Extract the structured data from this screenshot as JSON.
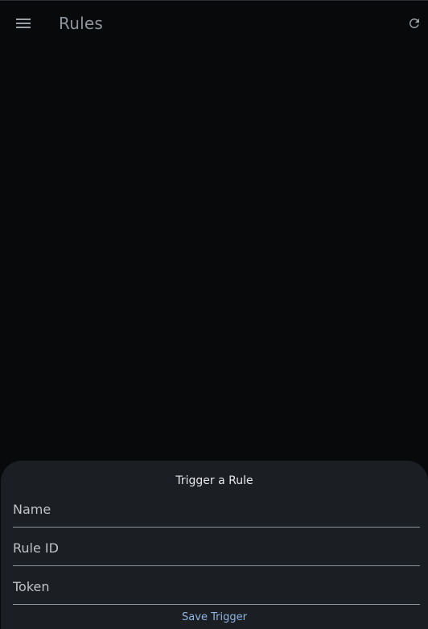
{
  "appbar": {
    "title": "Rules",
    "menu_icon": "menu-icon",
    "refresh_icon": "refresh-icon"
  },
  "sheet": {
    "title": "Trigger a Rule",
    "fields": [
      {
        "placeholder": "Name",
        "value": ""
      },
      {
        "placeholder": "Rule ID",
        "value": ""
      },
      {
        "placeholder": "Token",
        "value": ""
      }
    ],
    "save_label": "Save Trigger"
  },
  "colors": {
    "background": "#08090b",
    "sheet": "#1b1e23",
    "accent": "#8fb4e0",
    "title_text": "#8e949b"
  }
}
